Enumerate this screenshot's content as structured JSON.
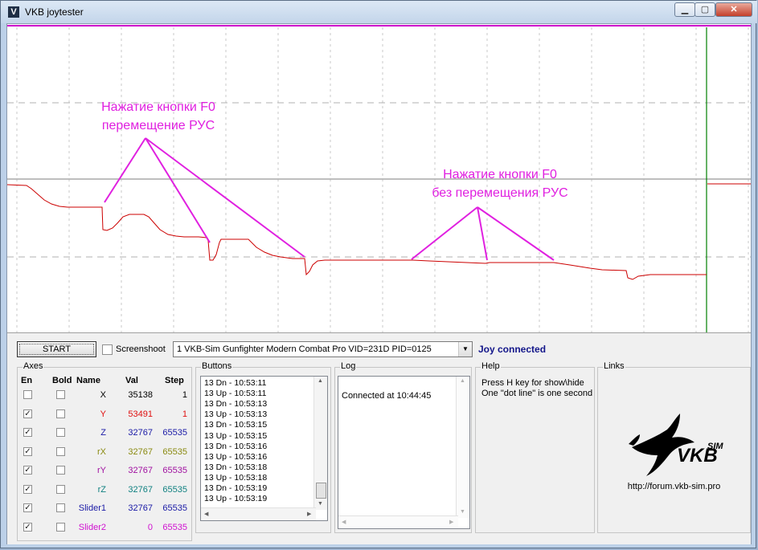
{
  "window": {
    "title": "VKB joytester",
    "app_icon": "V"
  },
  "annotations": [
    {
      "lines": [
        "Нажатие кнопки F0",
        "перемещение РУС"
      ]
    },
    {
      "lines": [
        "Нажатие кнопки F0",
        "без перемещения РУС"
      ]
    }
  ],
  "toolbar": {
    "start_label": "START",
    "screenshot_label": "Screenshoot",
    "screenshot_checked": false,
    "device_selected": "1  VKB-Sim Gunfighter Modern Combat Pro  VID=231D PID=0125",
    "status": "Joy connected"
  },
  "axes": {
    "title": "Axes",
    "headers": {
      "en": "En",
      "bold": "Bold",
      "name": "Name",
      "val": "Val",
      "step": "Step"
    },
    "rows": [
      {
        "enabled": false,
        "bold": false,
        "name": "X",
        "val": "35138",
        "step": "1",
        "color": "#000000"
      },
      {
        "enabled": true,
        "bold": false,
        "name": "Y",
        "val": "53491",
        "step": "1",
        "color": "#e01010"
      },
      {
        "enabled": true,
        "bold": false,
        "name": "Z",
        "val": "32767",
        "step": "65535",
        "color": "#1a1aa6"
      },
      {
        "enabled": true,
        "bold": false,
        "name": "rX",
        "val": "32767",
        "step": "65535",
        "color": "#8a8a10"
      },
      {
        "enabled": true,
        "bold": false,
        "name": "rY",
        "val": "32767",
        "step": "65535",
        "color": "#a010a0"
      },
      {
        "enabled": true,
        "bold": false,
        "name": "rZ",
        "val": "32767",
        "step": "65535",
        "color": "#108080"
      },
      {
        "enabled": true,
        "bold": false,
        "name": "Slider1",
        "val": "32767",
        "step": "65535",
        "color": "#1a1aa6"
      },
      {
        "enabled": true,
        "bold": false,
        "name": "Slider2",
        "val": "0",
        "step": "65535",
        "color": "#d010d0"
      }
    ]
  },
  "buttons": {
    "title": "Buttons",
    "events": [
      "13 Dn - 10:53:11",
      "13 Up - 10:53:11",
      "13 Dn - 10:53:13",
      "13 Up - 10:53:13",
      "13 Dn - 10:53:15",
      "13 Up - 10:53:15",
      "13 Dn - 10:53:16",
      "13 Up - 10:53:16",
      "13 Dn - 10:53:18",
      "13 Up - 10:53:18",
      "13 Dn - 10:53:19",
      "13 Up - 10:53:19"
    ]
  },
  "log": {
    "title": "Log",
    "lines": [
      "Connected at 10:44:45"
    ]
  },
  "help": {
    "title": "Help",
    "lines": [
      "Press H key for show\\hide",
      "One \"dot line\" is one second"
    ]
  },
  "links": {
    "title": "Links",
    "logo_text": "VKB",
    "logo_sup": "SIM",
    "url": "http://forum.vkb-sim.pro"
  },
  "colors": {
    "trace": "#cc0000",
    "annotation": "#e020e0",
    "cursor": "#008000",
    "top_line": "#cc00cc",
    "status": "#13168a"
  }
}
